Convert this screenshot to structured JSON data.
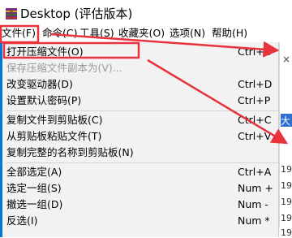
{
  "window": {
    "title": "Desktop (评估版本)"
  },
  "menubar": {
    "items": [
      "文件(F)",
      "命令(C)",
      "工具(S)",
      "收藏夹(O)",
      "选项(N)",
      "帮助(H)"
    ]
  },
  "file_menu": {
    "items": [
      {
        "label": "打开压缩文件(O)",
        "shortcut": "Ctrl+O",
        "enabled": true
      },
      {
        "label": "保存压缩文件副本为(V)...",
        "shortcut": "",
        "enabled": false
      },
      {
        "label": "改变驱动器(D)",
        "shortcut": "Ctrl+D",
        "enabled": true
      },
      {
        "label": "设置默认密码(P)",
        "shortcut": "Ctrl+P",
        "enabled": true
      },
      {
        "label": "复制文件到剪贴板(C)",
        "shortcut": "Ctrl+C",
        "enabled": true
      },
      {
        "label": "从剪贴板粘贴文件(T)",
        "shortcut": "Ctrl+V",
        "enabled": true
      },
      {
        "label": "复制完整的名称到剪贴板(N)",
        "shortcut": "",
        "enabled": true
      },
      {
        "label": "全部选定(A)",
        "shortcut": "Ctrl+A",
        "enabled": true
      },
      {
        "label": "选定一组(S)",
        "shortcut": "Num +",
        "enabled": true
      },
      {
        "label": "撤选一组(D)",
        "shortcut": "Num -",
        "enabled": true
      },
      {
        "label": "反选(I)",
        "shortcut": "Num *",
        "enabled": true
      }
    ]
  },
  "right_pane": {
    "close_glyph": "×",
    "selected_text": "大",
    "fragments": [
      "19",
      "19",
      "19",
      "19",
      "19"
    ]
  },
  "colors": {
    "highlight_box": "#e8323c",
    "arrow": "#e8323c",
    "menu_background": "#f2f2f2",
    "accent": "#0078d7",
    "selected_row": "#2f6fd4"
  }
}
